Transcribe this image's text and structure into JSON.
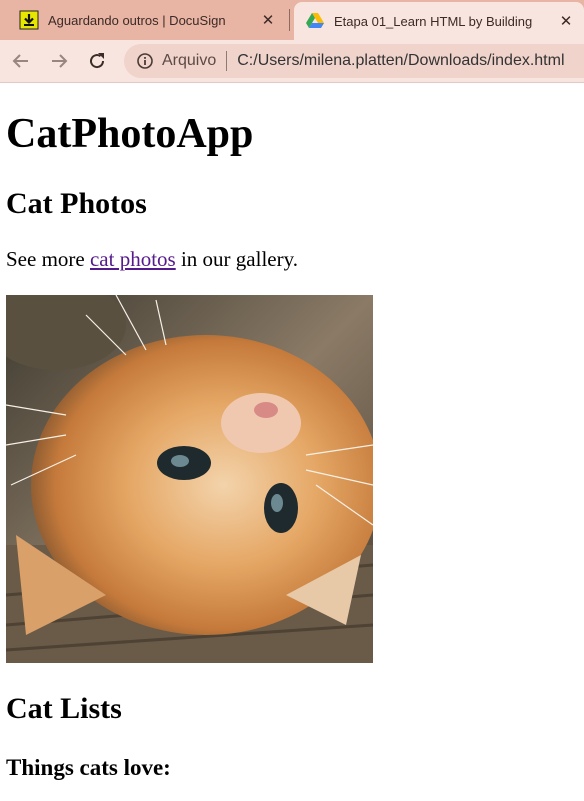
{
  "browser": {
    "tabs": [
      {
        "title": "Aguardando outros | DocuSign",
        "favicon": "download-favicon",
        "active": false
      },
      {
        "title": "Etapa 01_Learn HTML by Building",
        "favicon": "google-drive-favicon",
        "active": true
      }
    ],
    "close_glyph": "✕",
    "address": {
      "scheme_label": "Arquivo",
      "url": "C:/Users/milena.platten/Downloads/index.html"
    }
  },
  "page": {
    "title": "CatPhotoApp",
    "cat_photos_heading": "Cat Photos",
    "see_more_prefix": "See more ",
    "link_text": "cat photos",
    "see_more_suffix": " in our gallery.",
    "cat_lists_heading": "Cat Lists",
    "things_heading": "Things cats love:",
    "link_color": "#551a8b"
  }
}
